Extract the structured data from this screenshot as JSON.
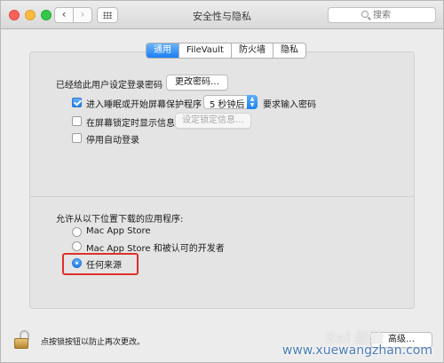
{
  "window": {
    "title": "安全性与隐私"
  },
  "search": {
    "placeholder": "搜索"
  },
  "nav": {
    "back_symbol": "‹",
    "forward_symbol": "›"
  },
  "tabs": [
    {
      "label": "通用",
      "active": true
    },
    {
      "label": "FileVault",
      "active": false
    },
    {
      "label": "防火墙",
      "active": false
    },
    {
      "label": "隐私",
      "active": false
    }
  ],
  "general": {
    "login_password_text": "已经给此用户设定登录密码",
    "change_password_button": "更改密码…",
    "require_password": {
      "label": "进入睡眠或开始屏幕保护程序",
      "checked": true
    },
    "delay_select_value": "5 秒钟后",
    "require_password_suffix": "要求输入密码",
    "show_message": {
      "label": "在屏幕锁定时显示信息",
      "checked": false
    },
    "set_lock_message_button": "设定锁定信息…",
    "disable_auto_login": {
      "label": "停用自动登录",
      "checked": false
    }
  },
  "downloads": {
    "heading": "允许从以下位置下载的应用程序:",
    "options": [
      {
        "label": "Mac App Store",
        "selected": false
      },
      {
        "label": "Mac App Store 和被认可的开发者",
        "selected": false
      },
      {
        "label": "任何来源",
        "selected": true
      }
    ]
  },
  "footer": {
    "lock_text": "点按锁按钮以防止再次更改。",
    "advanced_button": "高级…"
  },
  "watermark": {
    "text": "www.xuewangzhan.com"
  },
  "colors": {
    "accent": "#1b7ff3",
    "highlight": "#e0302a"
  }
}
